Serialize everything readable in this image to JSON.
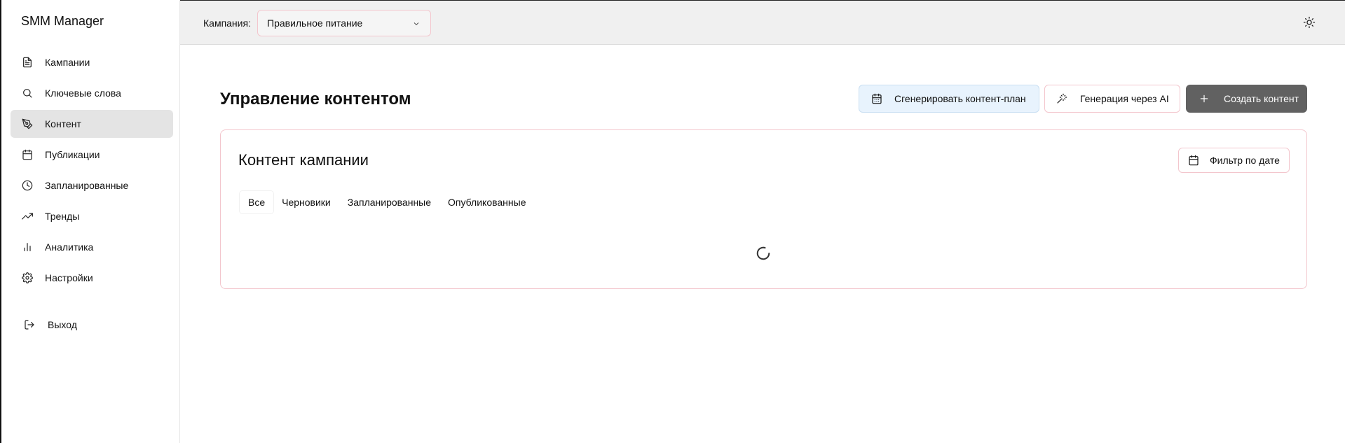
{
  "app": {
    "title": "SMM Manager"
  },
  "sidebar": {
    "items": [
      {
        "label": "Кампании",
        "icon": "file-text-icon"
      },
      {
        "label": "Ключевые слова",
        "icon": "search-icon"
      },
      {
        "label": "Контент",
        "icon": "pen-tool-icon",
        "active": true
      },
      {
        "label": "Публикации",
        "icon": "calendar-icon"
      },
      {
        "label": "Запланированные",
        "icon": "clock-icon"
      },
      {
        "label": "Тренды",
        "icon": "trending-up-icon"
      },
      {
        "label": "Аналитика",
        "icon": "bar-chart-icon"
      },
      {
        "label": "Настройки",
        "icon": "settings-icon"
      }
    ],
    "logout_label": "Выход"
  },
  "topbar": {
    "campaign_label": "Кампания:",
    "campaign_selected": "Правильное питание"
  },
  "main": {
    "title": "Управление контентом",
    "actions": {
      "generate_plan": "Сгенерировать контент-план",
      "ai_generation": "Генерация через AI",
      "create_content": "Создать контент"
    },
    "card": {
      "title": "Контент кампании",
      "filter_label": "Фильтр по дате",
      "tabs": [
        "Все",
        "Черновики",
        "Запланированные",
        "Опубликованные"
      ],
      "active_tab": "Все"
    }
  },
  "colors": {
    "active_nav_bg": "#e4e4e4",
    "accent_border": "#f3c6cd",
    "primary_button": "#616161",
    "plan_button_bg": "#e8f3fd"
  }
}
